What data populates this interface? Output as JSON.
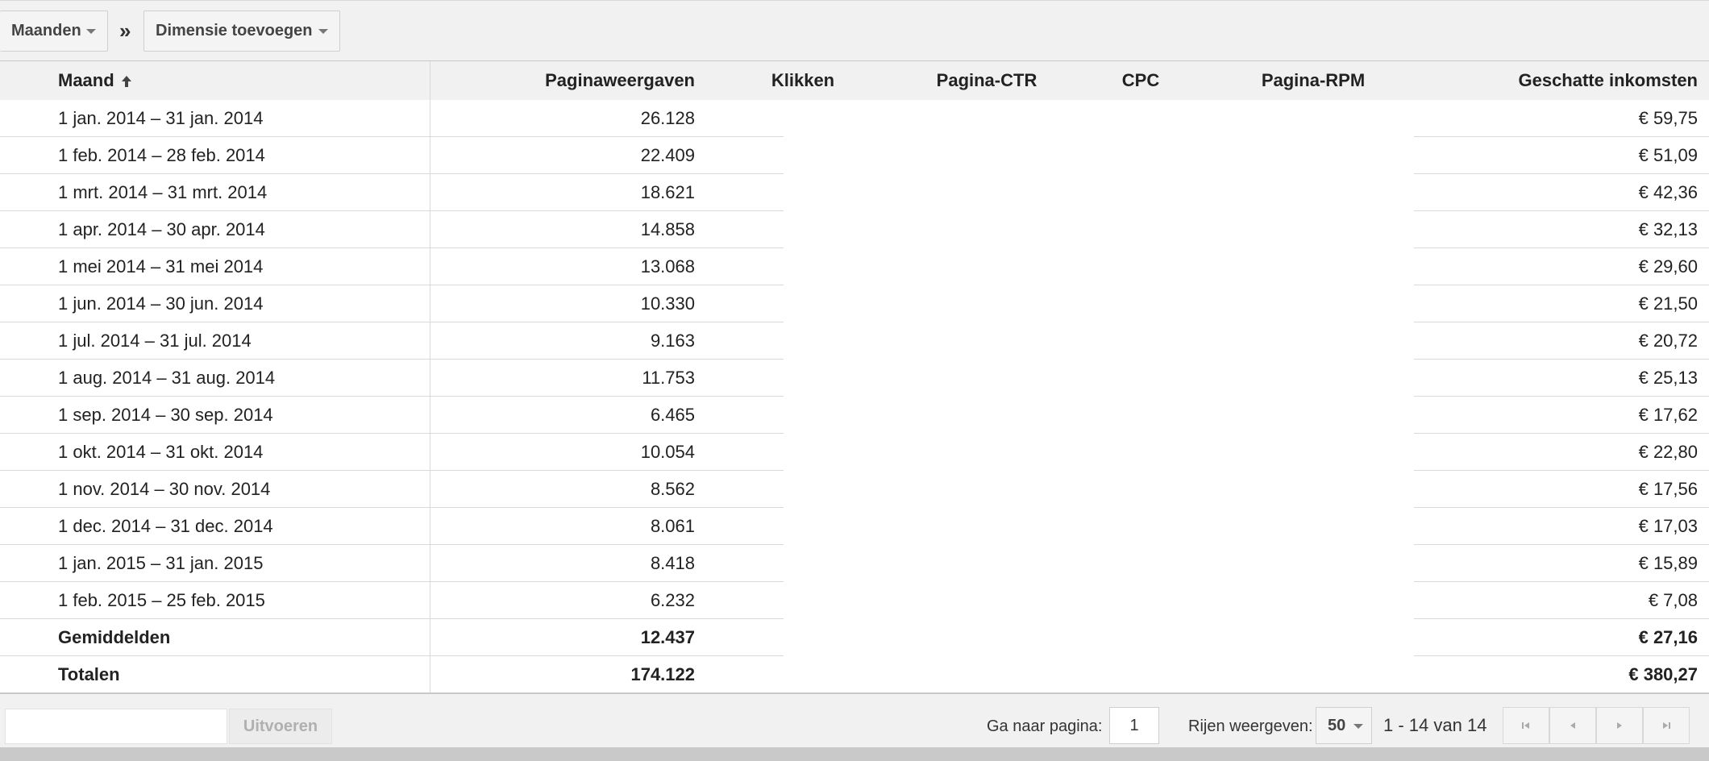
{
  "toolbar": {
    "dimension_select": "Maanden",
    "separator": "»",
    "add_dimension": "Dimensie toevoegen"
  },
  "table": {
    "headers": {
      "maand": "Maand",
      "paginaweergaven": "Paginaweergaven",
      "klikken": "Klikken",
      "pagina_ctr": "Pagina-CTR",
      "cpc": "CPC",
      "pagina_rpm": "Pagina-RPM",
      "geschatte_inkomsten": "Geschatte inkomsten"
    },
    "sort_column": "Maand",
    "sort_direction": "ascending",
    "rows": [
      {
        "maand": "1 jan. 2014 – 31 jan. 2014",
        "paginaweergaven": "26.128",
        "inkomsten": "€ 59,75"
      },
      {
        "maand": "1 feb. 2014 – 28 feb. 2014",
        "paginaweergaven": "22.409",
        "inkomsten": "€ 51,09"
      },
      {
        "maand": "1 mrt. 2014 – 31 mrt. 2014",
        "paginaweergaven": "18.621",
        "inkomsten": "€ 42,36"
      },
      {
        "maand": "1 apr. 2014 – 30 apr. 2014",
        "paginaweergaven": "14.858",
        "inkomsten": "€ 32,13"
      },
      {
        "maand": "1 mei 2014 – 31 mei 2014",
        "paginaweergaven": "13.068",
        "inkomsten": "€ 29,60"
      },
      {
        "maand": "1 jun. 2014 – 30 jun. 2014",
        "paginaweergaven": "10.330",
        "inkomsten": "€ 21,50"
      },
      {
        "maand": "1 jul. 2014 – 31 jul. 2014",
        "paginaweergaven": "9.163",
        "inkomsten": "€ 20,72"
      },
      {
        "maand": "1 aug. 2014 – 31 aug. 2014",
        "paginaweergaven": "11.753",
        "inkomsten": "€ 25,13"
      },
      {
        "maand": "1 sep. 2014 – 30 sep. 2014",
        "paginaweergaven": "6.465",
        "inkomsten": "€ 17,62"
      },
      {
        "maand": "1 okt. 2014 – 31 okt. 2014",
        "paginaweergaven": "10.054",
        "inkomsten": "€ 22,80"
      },
      {
        "maand": "1 nov. 2014 – 30 nov. 2014",
        "paginaweergaven": "8.562",
        "inkomsten": "€ 17,56"
      },
      {
        "maand": "1 dec. 2014 – 31 dec. 2014",
        "paginaweergaven": "8.061",
        "inkomsten": "€ 17,03"
      },
      {
        "maand": "1 jan. 2015 – 31 jan. 2015",
        "paginaweergaven": "8.418",
        "inkomsten": "€ 15,89"
      },
      {
        "maand": "1 feb. 2015 – 25 feb. 2015",
        "paginaweergaven": "6.232",
        "inkomsten": "€ 7,08"
      }
    ],
    "averages": {
      "label": "Gemiddelden",
      "paginaweergaven": "12.437",
      "inkomsten": "€ 27,16"
    },
    "totals": {
      "label": "Totalen",
      "paginaweergaven": "174.122",
      "inkomsten": "€ 380,27"
    }
  },
  "footer": {
    "filter_value": "",
    "run_button": "Uitvoeren",
    "goto_page_label": "Ga naar pagina:",
    "page_value": "1",
    "rows_label": "Rijen weergeven:",
    "rows_value": "50",
    "range_text": "1 - 14 van 14"
  },
  "icons": {
    "sort": "arrow-up-icon",
    "first": "first-page-icon",
    "prev": "prev-page-icon",
    "next": "next-page-icon",
    "last": "last-page-icon"
  },
  "colors": {
    "toolbar_bg": "#f1f1f1",
    "grid_line": "#d9d9d9",
    "disabled_text": "#b0b0b0"
  }
}
